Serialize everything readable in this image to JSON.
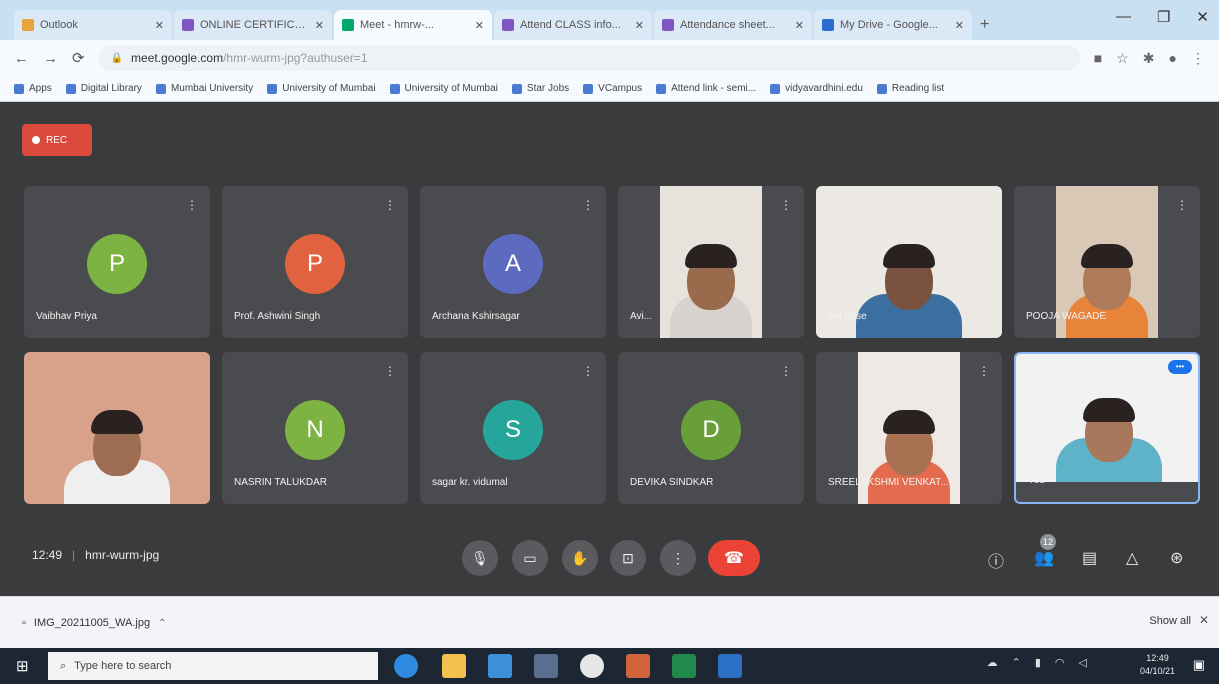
{
  "browser": {
    "tabs": [
      {
        "label": "Outlook",
        "favicon_color": "#e8a33b",
        "active": false
      },
      {
        "label": "ONLINE CERTIFICA...",
        "favicon_color": "#7e57c2",
        "active": false
      },
      {
        "label": "Meet - hmrw-...",
        "favicon_color": "#00a86b",
        "active": true
      },
      {
        "label": "Attend CLASS info...",
        "favicon_color": "#7e57c2",
        "active": false
      },
      {
        "label": "Attendance sheet...",
        "favicon_color": "#7e57c2",
        "active": false
      },
      {
        "label": "My Drive - Google...",
        "favicon_color": "#2c6dd5",
        "active": false
      }
    ],
    "new_tab_label": "+",
    "window_controls": [
      "—",
      "❐",
      "✕"
    ],
    "url_host": "meet.google.com",
    "url_path": "/hmr-wurm-jpg?authuser=1",
    "bookmarks": [
      "Apps",
      "Digital Library",
      "Mumbai University",
      "University of Mumbai",
      "University of Mumbai",
      "Star Jobs",
      "VCampus",
      "Attend link - semi...",
      "vidyavardhini.edu",
      "Reading list"
    ]
  },
  "meet": {
    "rec_label": "REC",
    "tiles": [
      {
        "name": "Vaibhav Priya",
        "initial": "P",
        "avatar_color": "#7cb342",
        "kind": "avatar"
      },
      {
        "name": "Prof. Ashwini Singh",
        "initial": "P",
        "avatar_color": "#e0623f",
        "kind": "avatar"
      },
      {
        "name": "Archana Kshirsagar",
        "initial": "A",
        "avatar_color": "#5c6bc0",
        "kind": "avatar"
      },
      {
        "name": "Avi...",
        "kind": "video",
        "skin": "#9a6a4c",
        "shirt": "#d8d3cf",
        "bg": "#e8e2dc"
      },
      {
        "name": "Avi Wise",
        "kind": "video",
        "skin": "#7a5240",
        "shirt": "#3a6fa0",
        "bg": "#ece9e5"
      },
      {
        "name": "POOJA WAGADE",
        "kind": "video",
        "skin": "#b07b5a",
        "shirt": "#e8833a",
        "bg": "#d9c8b5"
      },
      {
        "name": "",
        "kind": "video",
        "skin": "#9d6d52",
        "shirt": "#f0efef",
        "bg": "#d8a189"
      },
      {
        "name": "NASRIN TALUKDAR",
        "initial": "N",
        "avatar_color": "#7cb342",
        "kind": "avatar"
      },
      {
        "name": "sagar kr. vidumal",
        "initial": "S",
        "avatar_color": "#26a69a",
        "kind": "avatar"
      },
      {
        "name": "DEVIKA SINDKAR",
        "initial": "D",
        "avatar_color": "#689f38",
        "kind": "avatar"
      },
      {
        "name": "SREELAKSHMI VENKAT...",
        "kind": "video",
        "skin": "#a87252",
        "shirt": "#e36c4f",
        "bg": "#eee9e4"
      },
      {
        "name": "You",
        "kind": "video",
        "skin": "#a9775b",
        "shirt": "#5fb3c8",
        "bg": "#f2f2f2",
        "self": true
      }
    ],
    "time": "12:49",
    "meeting_code": "hmr-wurm-jpg",
    "participant_count": "12",
    "self_badge": "•••"
  },
  "download": {
    "file_name": "IMG_20211005_WA.jpg",
    "show_all": "Show all"
  },
  "taskbar": {
    "search_placeholder": "Type here to search",
    "clock_time": "12:49",
    "clock_date": "04/10/21"
  }
}
